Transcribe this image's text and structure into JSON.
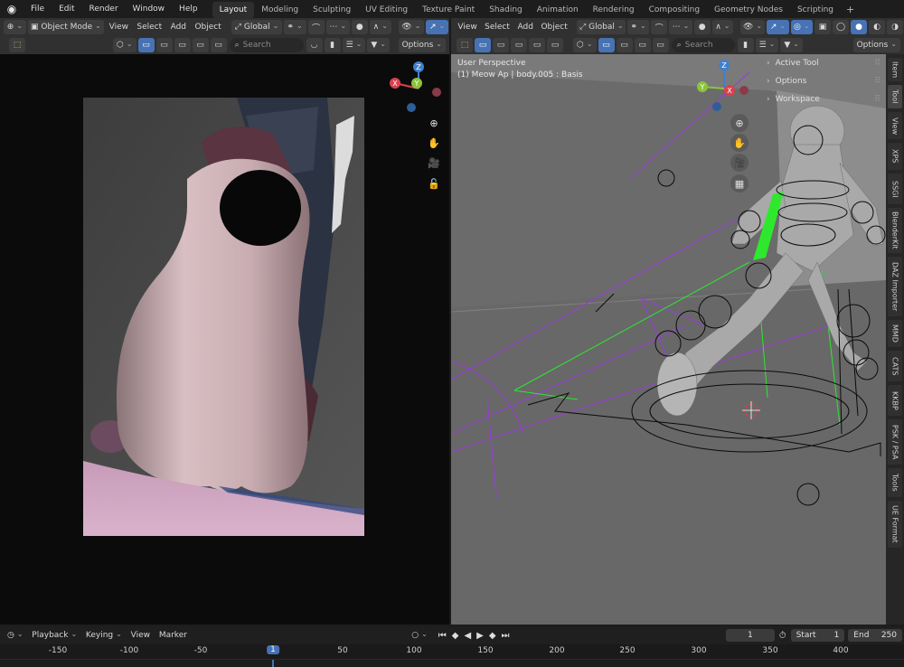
{
  "menu": {
    "items": [
      "File",
      "Edit",
      "Render",
      "Window",
      "Help"
    ]
  },
  "workspaces": {
    "tabs": [
      "Layout",
      "Modeling",
      "Sculpting",
      "UV Editing",
      "Texture Paint",
      "Shading",
      "Animation",
      "Rendering",
      "Compositing",
      "Geometry Nodes",
      "Scripting"
    ],
    "active": "Layout",
    "add": "+"
  },
  "left_header": {
    "mode": "Object Mode",
    "view": "View",
    "select": "Select",
    "add": "Add",
    "object": "Object",
    "orientation": "Global",
    "search_placeholder": "Search",
    "options": "Options"
  },
  "right_header": {
    "view": "View",
    "select": "Select",
    "add": "Add",
    "object": "Object",
    "orientation": "Global",
    "search_placeholder": "Search",
    "options": "Options"
  },
  "viewport": {
    "perspective": "User Perspective",
    "object_info": "(1) Meow Ap | body.005 : Basis"
  },
  "gizmo_axes": {
    "x": "X",
    "y": "Y",
    "z": "Z"
  },
  "npanel": {
    "items": [
      "Active Tool",
      "Options",
      "Workspace"
    ]
  },
  "side_tabs": [
    "Item",
    "Tool",
    "View",
    "XPS",
    "SSGI",
    "BlenderKit",
    "DAZ Importer",
    "MMD",
    "CATS",
    "KKBP",
    "PSK / PSA",
    "Tools",
    "UE Format"
  ],
  "side_tab_active": "Tool",
  "timeline": {
    "playback": "Playback",
    "keying": "Keying",
    "view": "View",
    "marker": "Marker",
    "current_frame": "1",
    "start_label": "Start",
    "start": "1",
    "end_label": "End",
    "end": "250",
    "ruler_ticks": [
      "-150",
      "-100",
      "-50",
      "1",
      "50",
      "100",
      "150",
      "200",
      "250",
      "300",
      "350",
      "400"
    ]
  },
  "colors": {
    "accent": "#4772b3",
    "axis_x": "#d9414e",
    "axis_y": "#8bc43b",
    "axis_z": "#3f7fcf",
    "bone_green": "#2ee82e",
    "bone_purple": "#9a3cdc"
  }
}
